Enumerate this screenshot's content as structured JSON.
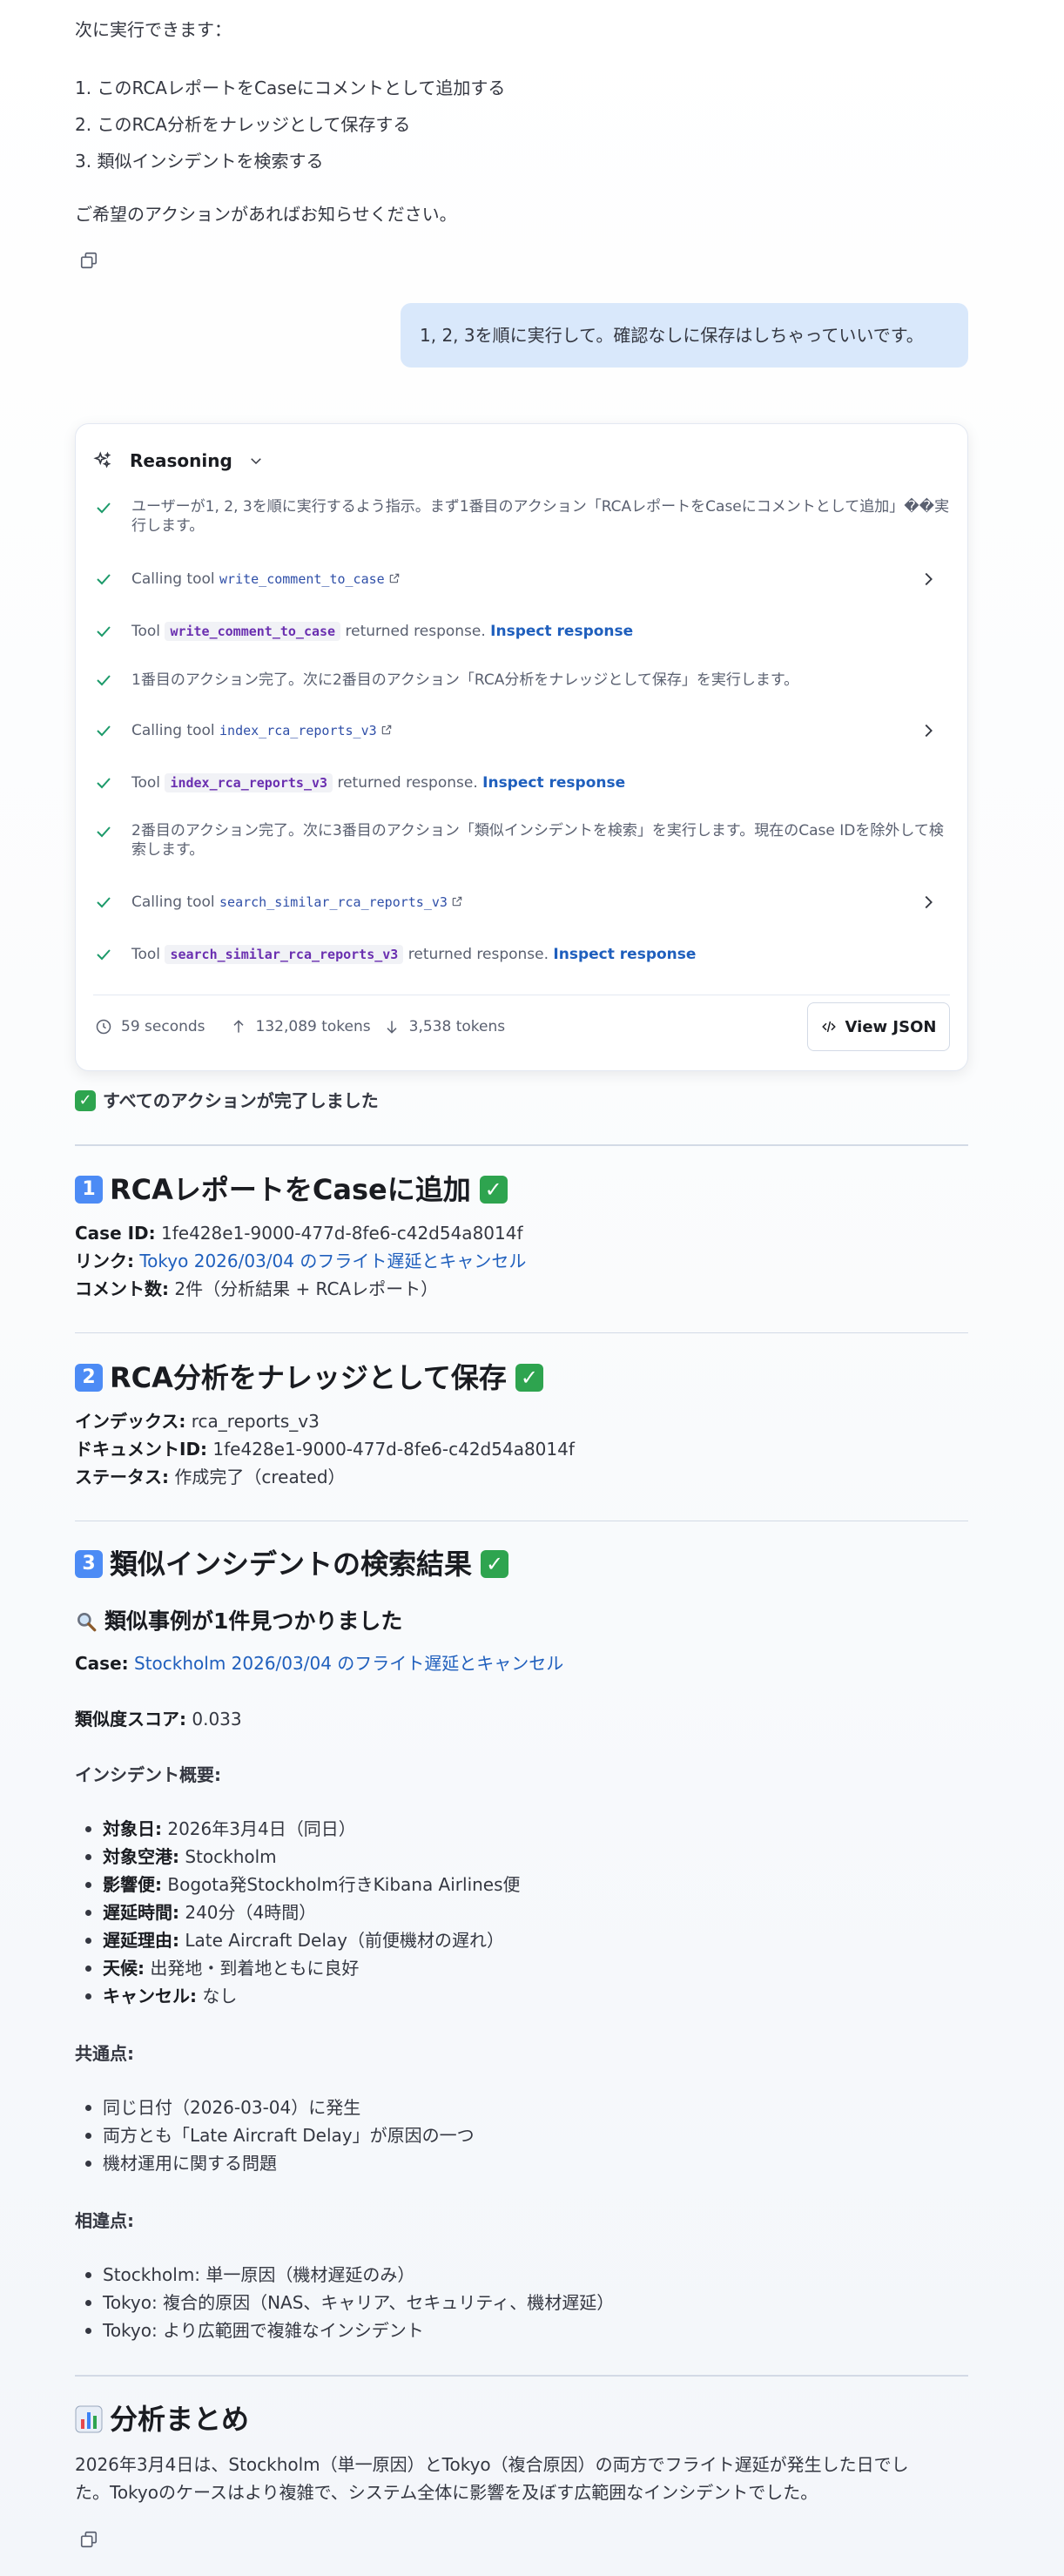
{
  "intro": {
    "lead": "次に実行できます：",
    "items": [
      "1. このRCAレポートをCaseにコメントとして追加する",
      "2. このRCA分析をナレッジとして保存する",
      "3. 類似インシデントを検索する"
    ],
    "closing": "ご希望のアクションがあればお知らせください。"
  },
  "user_message": "1, 2, 3を順に実行して。確認なしに保存はしちゃっていいです。",
  "reasoning": {
    "title": "Reasoning",
    "steps": [
      {
        "text": "ユーザーが1, 2, 3を順に実行するよう指示。まず1番目のアクション「RCAレポートをCaseにコメントとして追加」��実行します。"
      },
      {
        "prefix": "Calling tool",
        "tool": "write_comment_to_case"
      },
      {
        "prefix": "Tool",
        "tool": "write_comment_to_case",
        "suffix": "returned response.",
        "link": "Inspect response"
      },
      {
        "text": "1番目のアクション完了。次に2番目のアクション「RCA分析をナレッジとして保存」を実行します。"
      },
      {
        "prefix": "Calling tool",
        "tool": "index_rca_reports_v3"
      },
      {
        "prefix": "Tool",
        "tool": "index_rca_reports_v3",
        "suffix": "returned response.",
        "link": "Inspect response"
      },
      {
        "text": "2番目のアクション完了。次に3番目のアクション「類似インシデントを検索」を実行します。現在のCase IDを除外して検索します。"
      },
      {
        "prefix": "Calling tool",
        "tool": "search_similar_rca_reports_v3"
      },
      {
        "prefix": "Tool",
        "tool": "search_similar_rca_reports_v3",
        "suffix": "returned response.",
        "link": "Inspect response"
      }
    ],
    "duration": "59 seconds",
    "tokens_up": "132,089 tokens",
    "tokens_down": "3,538 tokens",
    "view_json": "View JSON"
  },
  "done_banner": "すべてのアクションが完了しました",
  "section1": {
    "num": "1",
    "title": "RCAレポートをCaseに追加",
    "case_id_label": "Case ID:",
    "case_id": "1fe428e1-9000-477d-8fe6-c42d54a8014f",
    "link_label": "リンク:",
    "link": "Tokyo 2026/03/04 のフライト遅延とキャンセル",
    "comments_label": "コメント数:",
    "comments": "2件（分析結果 + RCAレポート）"
  },
  "section2": {
    "num": "2",
    "title": "RCA分析をナレッジとして保存",
    "index_label": "インデックス:",
    "index": "rca_reports_v3",
    "doc_label": "ドキュメントID:",
    "doc": "1fe428e1-9000-477d-8fe6-c42d54a8014f",
    "status_label": "ステータス:",
    "status": "作成完了（created）"
  },
  "section3": {
    "num": "3",
    "title": "類似インシデントの検索結果",
    "subtitle": "類似事例が1件見つかりました",
    "case_label": "Case:",
    "case_link": "Stockholm 2026/03/04 のフライト遅延とキャンセル",
    "score_label": "類似度スコア:",
    "score": "0.033",
    "overview_label": "インシデント概要:",
    "overview": [
      {
        "k": "対象日:",
        "v": "2026年3月4日（同日）"
      },
      {
        "k": "対象空港:",
        "v": "Stockholm"
      },
      {
        "k": "影響便:",
        "v": "Bogota発Stockholm行きKibana Airlines便"
      },
      {
        "k": "遅延時間:",
        "v": "240分（4時間）"
      },
      {
        "k": "遅延理由:",
        "v": "Late Aircraft Delay（前便機材の遅れ）"
      },
      {
        "k": "天候:",
        "v": "出発地・到着地ともに良好"
      },
      {
        "k": "キャンセル:",
        "v": "なし"
      }
    ],
    "common_label": "共通点:",
    "common": [
      "同じ日付（2026-03-04）に発生",
      "両方とも「Late Aircraft Delay」が原因の一つ",
      "機材運用に関する問題"
    ],
    "diff_label": "相違点:",
    "diff": [
      "Stockholm: 単一原因（機材遅延のみ）",
      "Tokyo: 複合的原因（NAS、キャリア、セキュリティ、機材遅延）",
      "Tokyo: より広範囲で複雑なインシデント"
    ]
  },
  "summary": {
    "title": "分析まとめ",
    "line1": "2026年3月4日は、Stockholm（単一原因）とTokyo（複合原因）の両方でフライト遅延が発生した日でし",
    "line2": "た。Tokyoのケースはより複雑で、システム全体に影響を及ぼす広範囲なインシデントでした。"
  }
}
